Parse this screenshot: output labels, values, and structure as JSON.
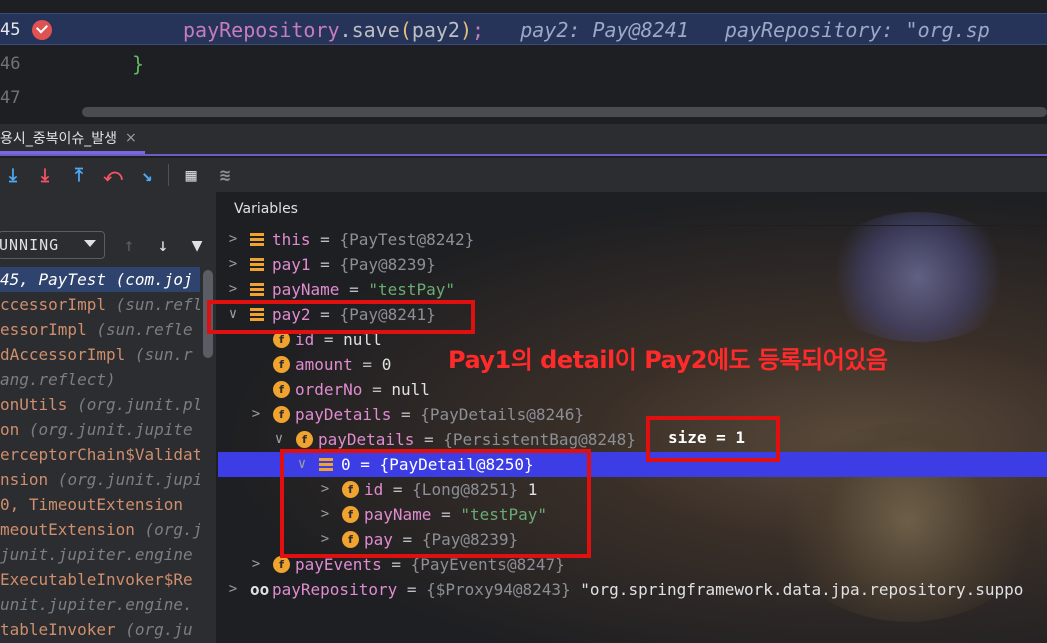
{
  "editor": {
    "lines": [
      {
        "num": "45",
        "text": {
          "obj": "payRepository",
          "method": ".save",
          "open": "(",
          "arg": "pay2",
          "close": ")",
          "semi": ";"
        },
        "hints": [
          "pay2: Pay@8241",
          "payRepository: \"org.sp"
        ]
      },
      {
        "num": "46",
        "brace": "}"
      },
      {
        "num": "47"
      }
    ]
  },
  "tab": {
    "label": "용시_중복이슈_발생",
    "close": "×"
  },
  "toolbar": {
    "icons": [
      {
        "name": "step-over-icon",
        "glyph": "⤓",
        "color": "#4eaaf5"
      },
      {
        "name": "step-into-icon",
        "glyph": "⤓",
        "color": "#f75464"
      },
      {
        "name": "step-out-icon",
        "glyph": "⤒",
        "color": "#4eaaf5"
      },
      {
        "name": "drop-frame-icon",
        "glyph": "⤺",
        "color": "#f75464"
      },
      {
        "name": "run-to-cursor-icon",
        "glyph": "↘",
        "color": "#4eaaf5"
      },
      {
        "name": "evaluate-icon",
        "glyph": "▦",
        "color": "#cfd1d6"
      },
      {
        "name": "trace-icon",
        "glyph": "≋",
        "color": "#8c8f96"
      }
    ]
  },
  "frames": {
    "thread": "UNNING",
    "items": [
      {
        "main": "45, PayTest",
        "ctx": " (com.joj",
        "selected": true
      },
      {
        "main": "ccessorImpl",
        "ctx": " (sun.refle"
      },
      {
        "main": "essorImpl",
        "ctx": " (sun.refle"
      },
      {
        "main": "dAccessorImpl",
        "ctx": " (sun.r"
      },
      {
        "main": "",
        "ctx": "ang.reflect)"
      },
      {
        "main": "onUtils",
        "ctx": " (org.junit.pl"
      },
      {
        "main": "on",
        "ctx": " (org.junit.jupite"
      },
      {
        "main": "erceptorChain$Validat",
        "ctx": ""
      },
      {
        "main": "nsion",
        "ctx": " (org.junit.jupi"
      },
      {
        "main": "0, TimeoutExtension",
        "ctx": ""
      },
      {
        "main": "meoutExtension",
        "ctx": " (org.j"
      },
      {
        "main": "",
        "ctx": "junit.jupiter.engine"
      },
      {
        "main": " ExecutableInvoker$Re",
        "ctx": ""
      },
      {
        "main": "",
        "ctx": "unit.jupiter.engine."
      },
      {
        "main": "tableInvoker",
        "ctx": " (org.ju"
      }
    ]
  },
  "variables": {
    "header": "Variables",
    "rows": [
      {
        "arrow": ">",
        "icon": "list",
        "name": "this",
        "eq": " = ",
        "ref": "{PayTest@8242}"
      },
      {
        "arrow": ">",
        "icon": "list",
        "name": "pay1",
        "eq": " = ",
        "ref": "{Pay@8239}"
      },
      {
        "arrow": ">",
        "icon": "list",
        "name": "payName",
        "eq": " = ",
        "str": "\"testPay\""
      },
      {
        "arrow": "∨",
        "icon": "list",
        "name": "pay2",
        "eq": " = ",
        "ref": "{Pay@8241}"
      },
      {
        "arrow": "",
        "icon": "field",
        "name": "id",
        "eq": " = ",
        "plain": "null"
      },
      {
        "arrow": "",
        "icon": "field",
        "name": "amount",
        "eq": " = ",
        "plain": "0"
      },
      {
        "arrow": "",
        "icon": "field",
        "name": "orderNo",
        "eq": " = ",
        "plain": "null"
      },
      {
        "arrow": ">",
        "icon": "field",
        "name": "payDetails",
        "eq": " = ",
        "ref": "{PayDetails@8246}"
      },
      {
        "arrow": "∨",
        "icon": "field",
        "name": "payDetails",
        "eq": " = ",
        "ref": "{PersistentBag@8248}"
      },
      {
        "arrow": "∨",
        "icon": "list",
        "name": "0",
        "eq": " = ",
        "ref": "{PayDetail@8250}",
        "selected": true
      },
      {
        "arrow": ">",
        "icon": "field",
        "name": "id",
        "eq": " = ",
        "ref": "{Long@8251}",
        "plain": " 1"
      },
      {
        "arrow": ">",
        "icon": "field",
        "name": "payName",
        "eq": " = ",
        "str": "\"testPay\""
      },
      {
        "arrow": ">",
        "icon": "field",
        "name": "pay",
        "eq": " = ",
        "ref": "{Pay@8239}"
      },
      {
        "arrow": ">",
        "icon": "field",
        "name": "payEvents",
        "eq": " = ",
        "ref": "{PayEvents@8247}"
      },
      {
        "arrow": ">",
        "icon": "infinity",
        "name": "payRepository",
        "eq": " = ",
        "ref": "{$Proxy94@8243}",
        "plain": " \"org.springframework.data.jpa.repository.suppo"
      }
    ]
  },
  "annotations": {
    "note": "Pay1의 detail이 Pay2에도 등록되어있음",
    "size": "size = 1"
  },
  "colors": {
    "accent": "#7a68e0",
    "highlight": "#e01010",
    "selection": "#3d3de6"
  }
}
